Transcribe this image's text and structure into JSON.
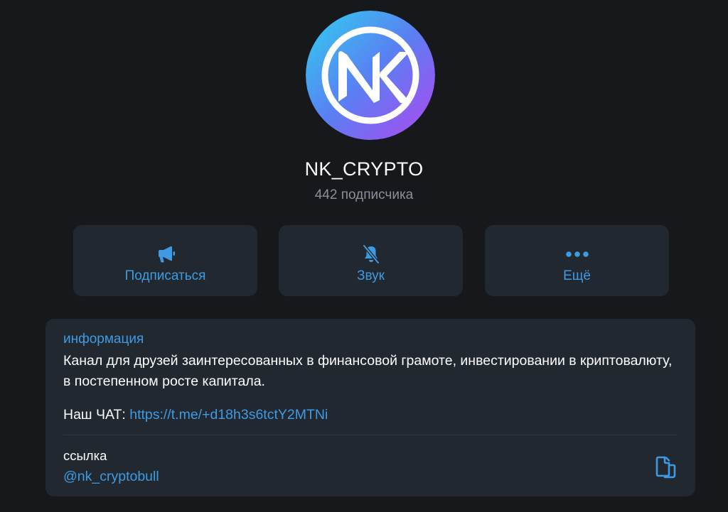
{
  "channel": {
    "title": "NK_CRYPTO",
    "subscribers": "442 подписчика",
    "avatar_text": "NK"
  },
  "actions": [
    {
      "label": "Подписаться",
      "icon": "megaphone-icon"
    },
    {
      "label": "Звук",
      "icon": "bell-muted-icon"
    },
    {
      "label": "Ещё",
      "icon": "more-dots-icon"
    }
  ],
  "info": {
    "heading": "информация",
    "description": "Канал для друзей заинтересованных в финансовой грамоте, инвестировании в криптовалюту, в постепенном росте капитала.",
    "chat_label": "Наш ЧАТ: ",
    "chat_link": "https://t.me/+d18h3s6tctY2MTNi",
    "link_heading": "ссылка",
    "username": "@nk_cryptobull",
    "copy_icon": "copy-icon"
  },
  "colors": {
    "background": "#16181b",
    "card": "#212830",
    "accent": "#3e9be3",
    "muted_text": "#8a9099",
    "avatar_gradient_start": "#2fd0f0",
    "avatar_gradient_end": "#a64bf0"
  }
}
